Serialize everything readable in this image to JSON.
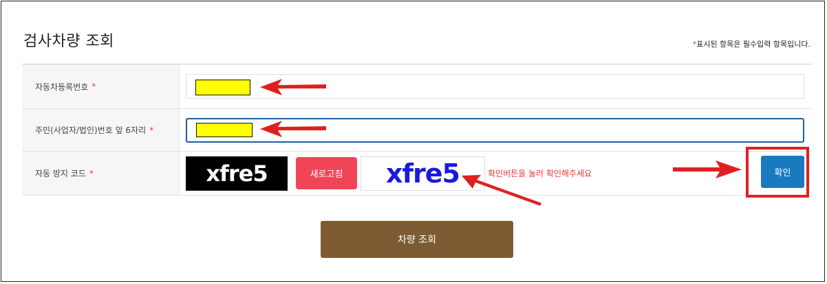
{
  "page": {
    "title": "검사차량 조회",
    "required_note_star": "*",
    "required_note_text": "표시된 항목은 필수입력 항목입니다."
  },
  "form": {
    "rows": [
      {
        "label": "자동차등록번호",
        "star": "*"
      },
      {
        "label": "주민(사업자/법인)번호 앞 6자리",
        "star": "*"
      },
      {
        "label": "자동 방지 코드",
        "star": "*"
      }
    ],
    "captcha": {
      "image_text": "xfre5",
      "input_value": "xfre5",
      "refresh_label": "새로고침",
      "hint": "확인버튼을 눌러 확인해주세요",
      "confirm_label": "확인"
    },
    "submit_label": "차량 조회"
  },
  "colors": {
    "required_star": "#e53935",
    "refresh_button": "#ef4557",
    "confirm_button": "#1a7abf",
    "submit_button": "#7d5c33",
    "annotation_red": "#e02020",
    "mask_yellow": "#ffff00"
  },
  "icons": {
    "annotation": "arrow-icon"
  }
}
